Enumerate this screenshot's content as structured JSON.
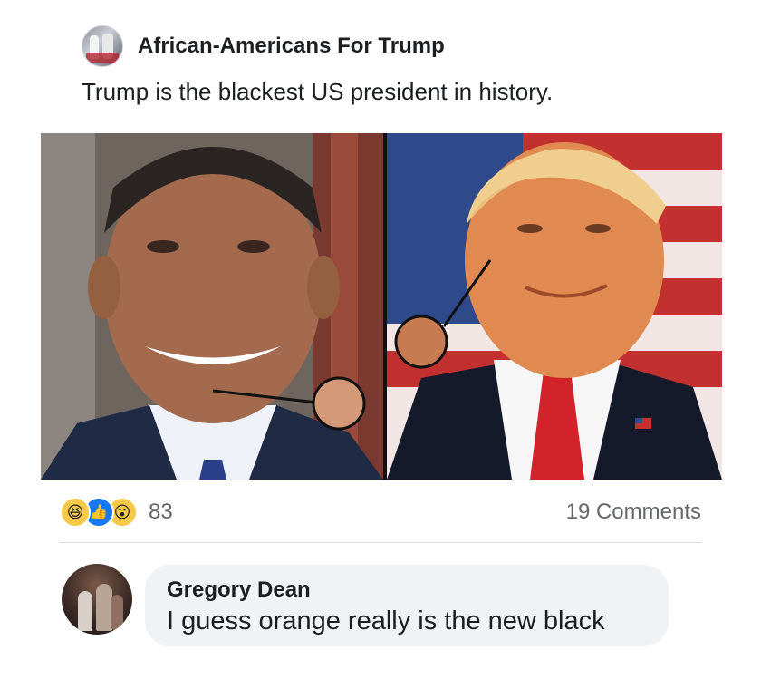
{
  "post": {
    "page_name": "African-Americans For Trump",
    "text": "Trump is the blackest US president in history."
  },
  "photo": {
    "swatch_left_color": "#d49a78",
    "swatch_right_color": "#c87a50"
  },
  "reactions": {
    "icons": [
      "haha-reaction",
      "like-reaction",
      "wow-reaction"
    ],
    "count": "83",
    "comments": "19 Comments"
  },
  "comment": {
    "author": "Gregory Dean",
    "text": "I guess orange really is the new black"
  }
}
